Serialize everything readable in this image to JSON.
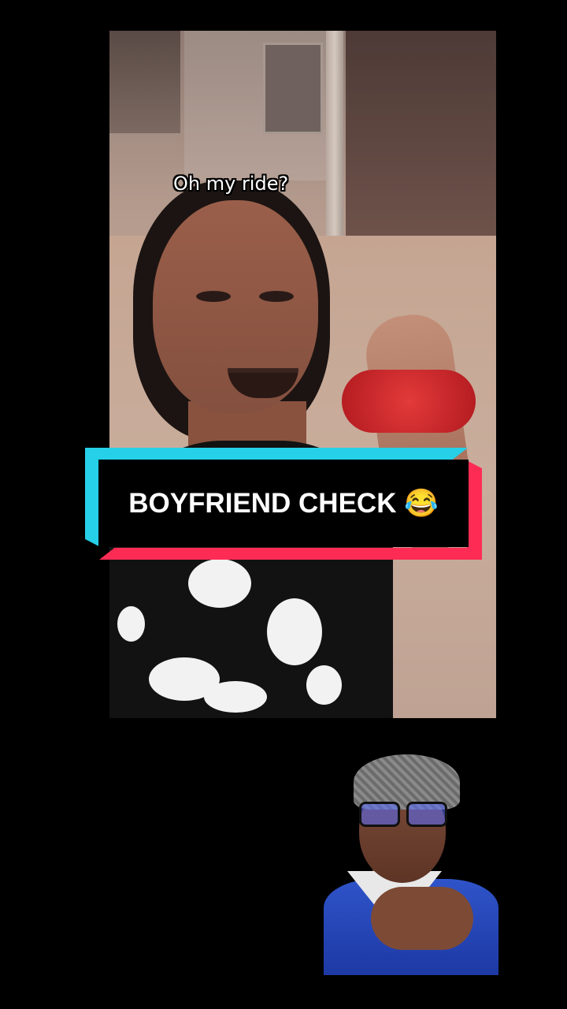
{
  "video": {
    "caption": "Oh my ride?"
  },
  "banner": {
    "text": "BOYFRIEND CHECK 😂",
    "colors": {
      "cyan": "#25d0e8",
      "pink": "#fe2c55",
      "background": "#000000",
      "text": "#ffffff"
    }
  }
}
